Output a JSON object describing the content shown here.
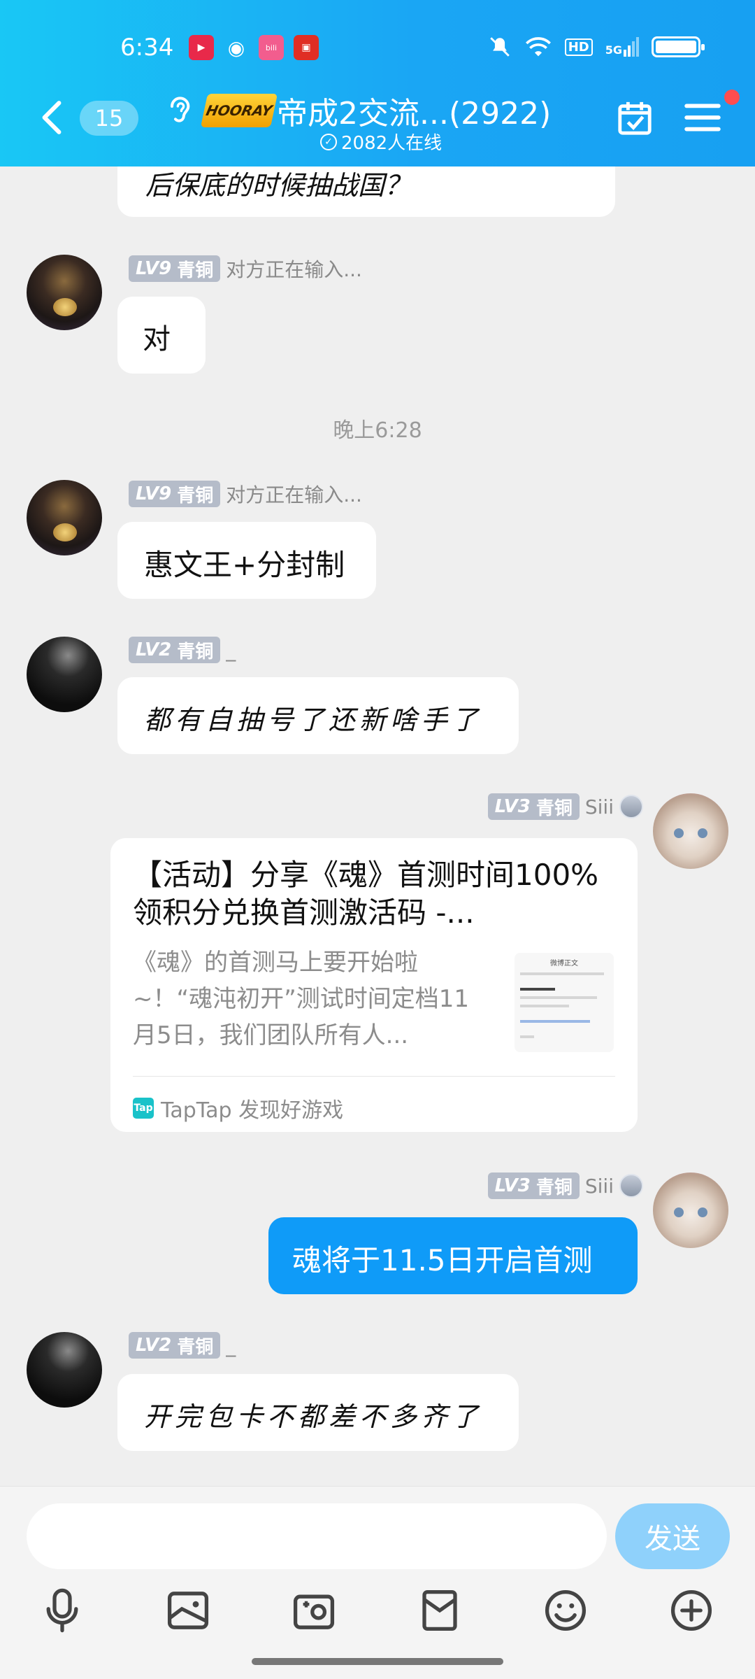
{
  "status_bar": {
    "time": "6:34",
    "icons": [
      "video-app-icon",
      "weibo-icon",
      "bilibili-icon",
      "shopping-icon"
    ],
    "sys_icons": [
      "mute-icon",
      "wifi-icon",
      "hd-icon",
      "5g-signal-icon",
      "battery-icon"
    ],
    "hd": "HD",
    "network": "5G"
  },
  "header": {
    "unread_count": "15",
    "group_logo": "HOORAY",
    "title": "帝成2交流...(2922)",
    "online": "2082人在线",
    "accent": "#18a9f3"
  },
  "messages": {
    "partial_text": "后保底的时候抽战国？",
    "m1": {
      "level": "LV9",
      "rank": "青铜",
      "name": "对方正在输入...",
      "text": "对"
    },
    "time_sep": "晚上6:28",
    "m2": {
      "level": "LV9",
      "rank": "青铜",
      "name": "对方正在输入...",
      "text": "惠文王+分封制"
    },
    "m3": {
      "level": "LV2",
      "rank": "青铜",
      "name": "_",
      "text": "都有自抽号了还新啥手了"
    },
    "m4": {
      "level": "LV3",
      "rank": "青铜",
      "name": "Siii",
      "card_title": "【活动】分享《魂》首测时间100%领积分兑换首测激活码 -...",
      "card_desc": "《魂》的首测马上要开始啦~！“魂沌初开”测试时间定档11月5日，我们团队所有人...",
      "card_source": "TapTap 发现好游戏",
      "thumb_heading": "微博正文"
    },
    "m5": {
      "level": "LV3",
      "rank": "青铜",
      "name": "Siii",
      "text": "魂将于11.5日开启首测"
    },
    "m6": {
      "level": "LV2",
      "rank": "青铜",
      "name": "_",
      "text": "开完包卡不都差不多齐了"
    }
  },
  "input": {
    "placeholder": "",
    "send_label": "发送"
  },
  "toolbar": [
    "microphone-icon",
    "image-icon",
    "camera-icon",
    "red-packet-icon",
    "emoji-icon",
    "plus-icon"
  ]
}
